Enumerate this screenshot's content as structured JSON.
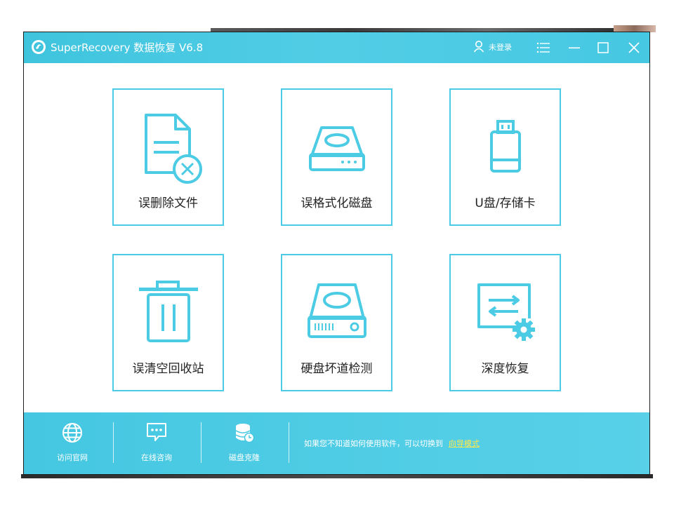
{
  "window": {
    "title": "SuperRecovery 数据恢复 V6.8",
    "user_label": "未登录",
    "icons": {
      "logo": "app-logo-icon",
      "user": "user-icon",
      "menu": "menu-icon",
      "minimize": "minimize-icon",
      "maximize": "maximize-icon",
      "close": "close-icon"
    }
  },
  "tiles": [
    {
      "label": "误删除文件",
      "icon": "deleted-file-icon"
    },
    {
      "label": "误格式化磁盘",
      "icon": "format-disk-icon"
    },
    {
      "label": "U盘/存储卡",
      "icon": "usb-drive-icon"
    },
    {
      "label": "误清空回收站",
      "icon": "recycle-bin-icon"
    },
    {
      "label": "硬盘坏道检测",
      "icon": "hard-disk-check-icon"
    },
    {
      "label": "深度恢复",
      "icon": "deep-recovery-icon"
    }
  ],
  "footer": {
    "items": [
      {
        "label": "访问官网",
        "icon": "globe-icon"
      },
      {
        "label": "在线咨询",
        "icon": "chat-icon"
      },
      {
        "label": "磁盘克隆",
        "icon": "disk-clone-icon"
      }
    ],
    "hint_text": "如果您不知道如何使用软件，可以切换到",
    "hint_link": "向导模式"
  },
  "colors": {
    "accent": "#4ccbe4",
    "titlebar": "#46c8e2",
    "link": "#ffe84a"
  }
}
